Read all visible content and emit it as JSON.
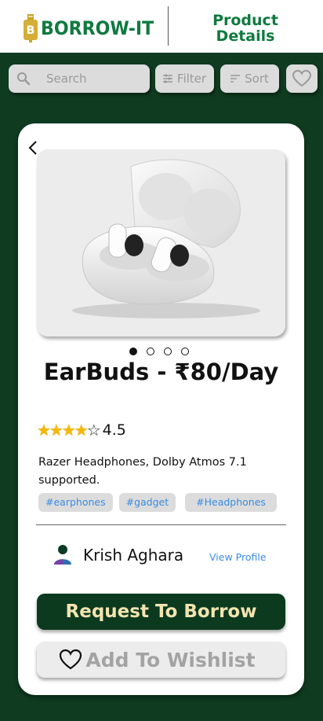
{
  "header": {
    "brand": "BORROW-IT",
    "page_title": "Product Details"
  },
  "toolbar": {
    "search_placeholder": "Search",
    "filter_label": "Filter",
    "sort_label": "Sort"
  },
  "product": {
    "title": "EarBuds - ₹80/Day",
    "image_count": 4,
    "active_image_index": 0,
    "rating": {
      "filled_stars": 4,
      "max_stars": 5,
      "value": "4.5"
    },
    "description": "Razer Headphones, Dolby Atmos 7.1 supported.",
    "tags": [
      "#earphones",
      "#gadget",
      "#Headphones"
    ]
  },
  "seller": {
    "name": "Krish Aghara",
    "view_profile_label": "View Profile"
  },
  "actions": {
    "borrow_label": "Request To Borrow",
    "wishlist_label": "Add To Wishlist"
  },
  "colors": {
    "background": "#0f3b20",
    "brand_green": "#0f7a3f",
    "borrow_button": "#0b3a1f",
    "borrow_text": "#f3e4b0",
    "link_blue": "#3b8be0",
    "star_gold": "#f5b800"
  }
}
